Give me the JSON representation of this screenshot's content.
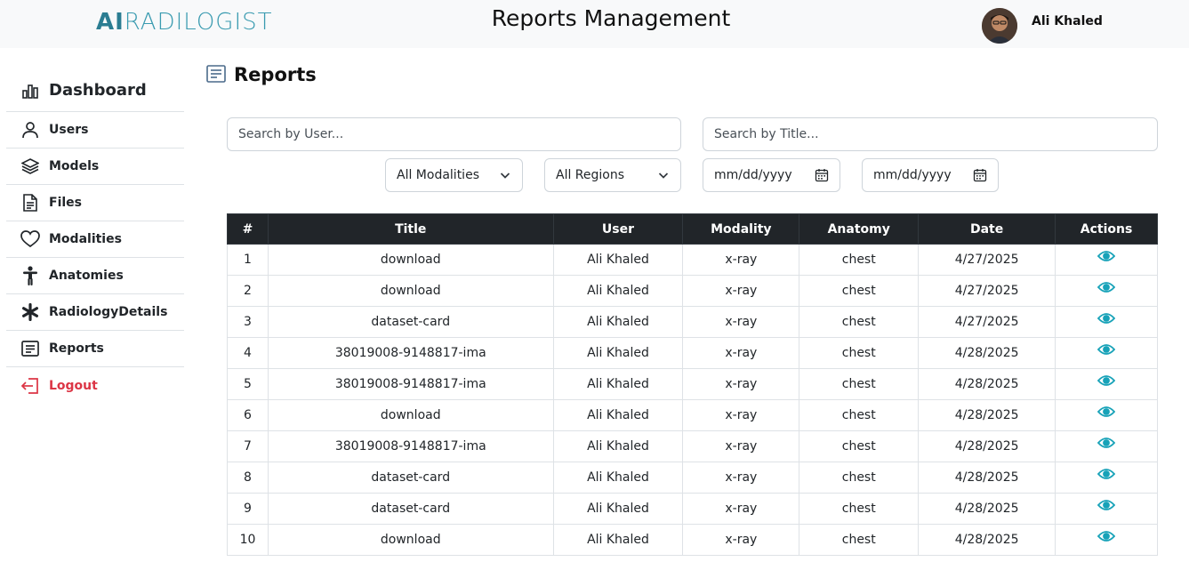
{
  "header": {
    "logo_text_ai": "AI",
    "logo_text_rest": "RADILOGIST",
    "app_title": "Reports Management",
    "user_name": "Ali Khaled"
  },
  "sidebar": {
    "items": [
      {
        "label": "Dashboard",
        "icon": "chart-bar-icon"
      },
      {
        "label": "Users",
        "icon": "person-icon"
      },
      {
        "label": "Models",
        "icon": "layers-icon"
      },
      {
        "label": "Files",
        "icon": "file-icon"
      },
      {
        "label": "Modalities",
        "icon": "heart-icon"
      },
      {
        "label": "Anatomies",
        "icon": "human-figure-icon"
      },
      {
        "label": "RadiologyDetails",
        "icon": "asterisk-icon"
      },
      {
        "label": "Reports",
        "icon": "report-icon"
      },
      {
        "label": "Logout",
        "icon": "logout-icon"
      }
    ]
  },
  "page": {
    "title": "Reports"
  },
  "filters": {
    "search_user_placeholder": "Search by User...",
    "search_title_placeholder": "Search by Title...",
    "modality_selected": "All Modalities",
    "region_selected": "All Regions",
    "date_from": "mm/dd/yyyy",
    "date_to": "mm/dd/yyyy"
  },
  "table": {
    "headers": [
      "#",
      "Title",
      "User",
      "Modality",
      "Anatomy",
      "Date",
      "Actions"
    ],
    "rows": [
      [
        "1",
        "download",
        "Ali Khaled",
        "x-ray",
        "chest",
        "4/27/2025"
      ],
      [
        "2",
        "download",
        "Ali Khaled",
        "x-ray",
        "chest",
        "4/27/2025"
      ],
      [
        "3",
        "dataset-card",
        "Ali Khaled",
        "x-ray",
        "chest",
        "4/27/2025"
      ],
      [
        "4",
        "38019008-9148817-ima",
        "Ali Khaled",
        "x-ray",
        "chest",
        "4/28/2025"
      ],
      [
        "5",
        "38019008-9148817-ima",
        "Ali Khaled",
        "x-ray",
        "chest",
        "4/28/2025"
      ],
      [
        "6",
        "download",
        "Ali Khaled",
        "x-ray",
        "chest",
        "4/28/2025"
      ],
      [
        "7",
        "38019008-9148817-ima",
        "Ali Khaled",
        "x-ray",
        "chest",
        "4/28/2025"
      ],
      [
        "8",
        "dataset-card",
        "Ali Khaled",
        "x-ray",
        "chest",
        "4/28/2025"
      ],
      [
        "9",
        "dataset-card",
        "Ali Khaled",
        "x-ray",
        "chest",
        "4/28/2025"
      ],
      [
        "10",
        "download",
        "Ali Khaled",
        "x-ray",
        "chest",
        "4/28/2025"
      ]
    ]
  },
  "colors": {
    "accent_eye": "#17a2b8",
    "header_bg": "#212529",
    "logout": "#dc3545",
    "logo": "#3a9bb0"
  }
}
